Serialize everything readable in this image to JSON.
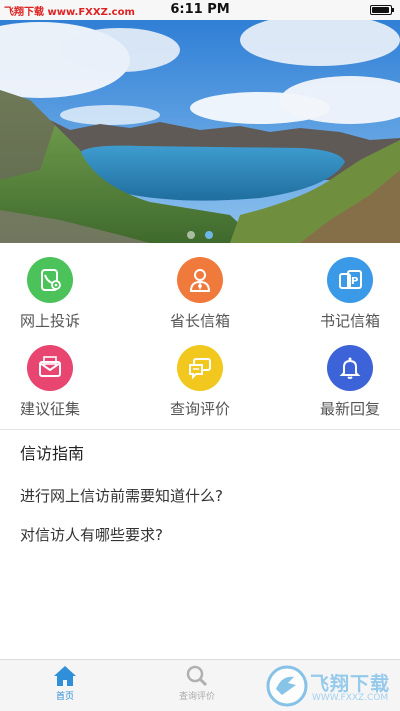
{
  "status_bar": {
    "carrier": "飞翔下载 www.FXXZ.com",
    "time": "6:11 PM"
  },
  "banner": {
    "slides": 2,
    "active_slide": 2
  },
  "grid": {
    "items": [
      {
        "label": "网上投诉",
        "icon": "phone-gear-icon",
        "color": "#4cc35a"
      },
      {
        "label": "省长信箱",
        "icon": "official-person-icon",
        "color": "#ef7a3c"
      },
      {
        "label": "书记信箱",
        "icon": "mailbox-icon",
        "color": "#3a9ae8"
      },
      {
        "label": "建议征集",
        "icon": "envelope-icon",
        "color": "#e84570"
      },
      {
        "label": "查询评价",
        "icon": "chat-bubbles-icon",
        "color": "#f3c81e"
      },
      {
        "label": "最新回复",
        "icon": "bell-icon",
        "color": "#3d63d8"
      }
    ]
  },
  "guide": {
    "title": "信访指南",
    "items": [
      "进行网上信访前需要知道什么?",
      "对信访人有哪些要求?"
    ]
  },
  "tab_bar": {
    "tabs": [
      {
        "label": "首页",
        "icon": "home-icon",
        "active": true
      },
      {
        "label": "查询评价",
        "icon": "search-icon",
        "active": false
      }
    ],
    "accent": "#2f8fd8"
  },
  "watermark": {
    "text": "飞翔下载",
    "url": "WWW.FXXZ.COM"
  }
}
